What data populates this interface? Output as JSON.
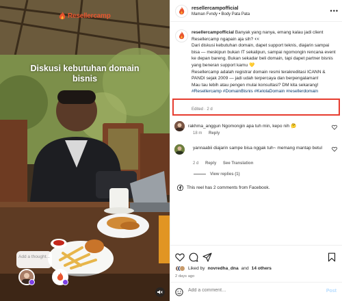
{
  "media": {
    "brand_logo_text": "Resellercamp",
    "overlay_caption": "Diskusi kebutuhan domain bisnis",
    "thought_placeholder": "Add a thought..."
  },
  "header": {
    "username": "resellercampofficial",
    "audio": "Maman Fvndy",
    "location": "Body Pata Pata",
    "separator": "•"
  },
  "caption": {
    "username": "resellercampofficial",
    "text": " Banyak yang nanya, emang kalau jadi client Resellercamp ngapain aja sih? 👀\nDari diskusi kebutuhan domain, dapet support teknis, diajarin sampai bisa — meskipun bukan IT sekalipun, sampai ngomongin rencana event ke depan bareng. Bukan sekadar beli domain, tapi dapet partner bisnis yang beneran support kamu 💛\nResellercamp adalah registrar domain resmi terakreditasi ICANN & PANDI sejak 2009 — jadi udah terpercaya dan berpengalaman!\nMau tau lebih atau pengen mulai konsultasi? DM kita sekarang!",
    "hashtags": "#Resellercamp #DomainBisnis #KelolaDomain #resellerdomain",
    "meta": "Edited · 2 d"
  },
  "comments": [
    {
      "username": "rakhma_anggun",
      "text": "Ngomongin apa tuh min, kepo nih 🤔",
      "time": "18 m",
      "reply_label": "Reply"
    },
    {
      "username": "yannaabii",
      "text": "diajarin sampe bisa nggak tuh~ memang mantap betul",
      "time": "2 d",
      "reply_label": "Reply",
      "translation_label": "See Translation",
      "view_replies": "View replies (1)"
    }
  ],
  "facebook_note": "This reel has 2 comments from Facebook.",
  "likes": {
    "prefix": "Liked by",
    "user": "novredha_dna",
    "connector": "and",
    "others": "14 others"
  },
  "time_ago": "2 days ago",
  "add_comment": {
    "placeholder": "Add a comment…",
    "post_label": "Post"
  },
  "colors": {
    "highlight": "#e63b2e",
    "link": "#00376b",
    "post_disabled": "#b3dbff",
    "brand": "#e8542e"
  }
}
